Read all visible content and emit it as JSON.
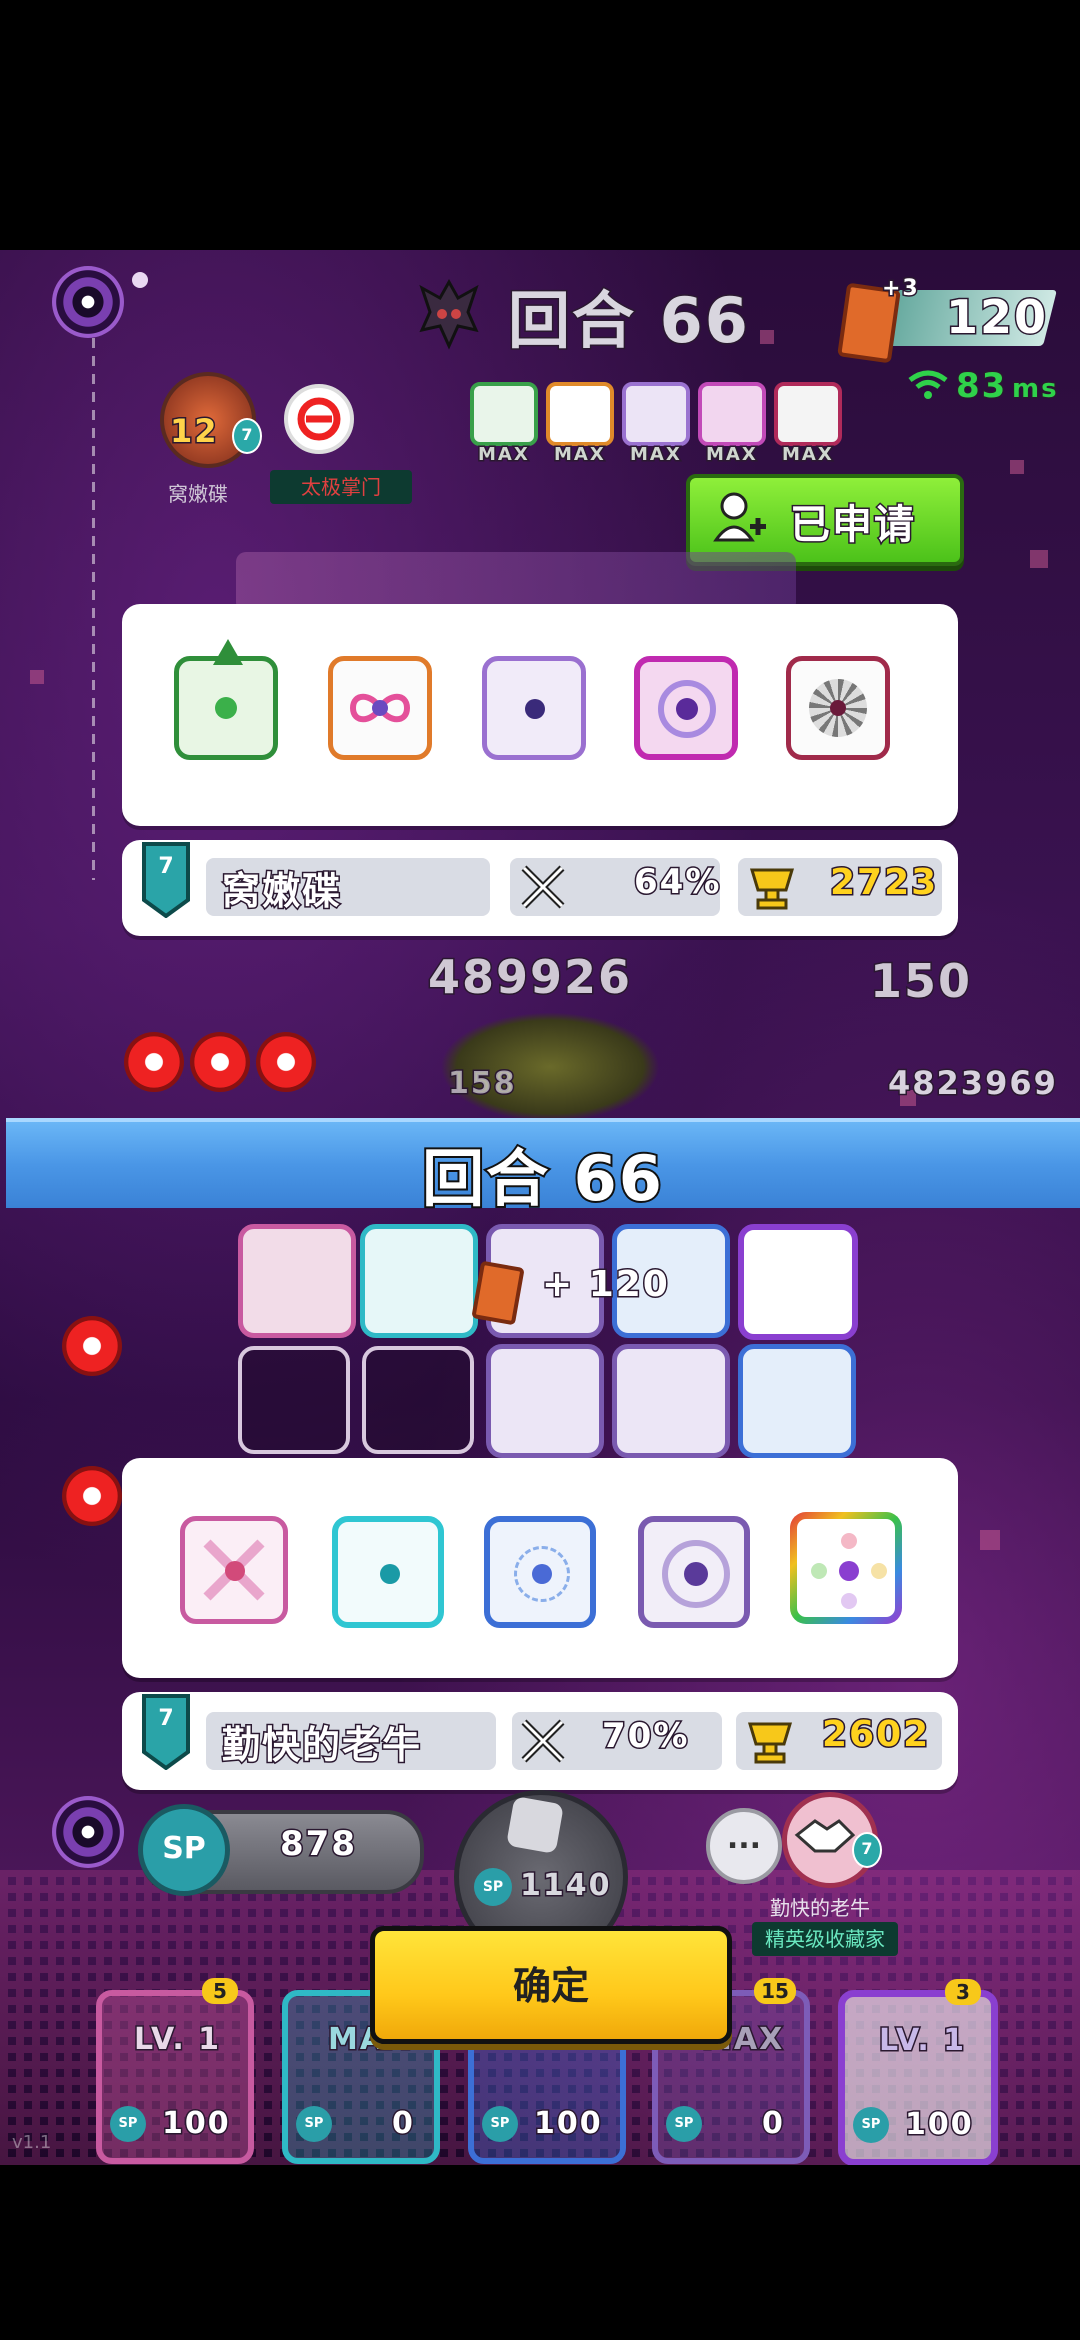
{
  "top_hud": {
    "round_label": "回合 66",
    "currency_bonus": "+3",
    "currency_value": "120",
    "ping_value": "83",
    "ping_unit": "ms",
    "player_level": "12",
    "player_badge": "7",
    "player_name": "窝嫩碟",
    "player_title": "太极掌门",
    "max_labels": [
      "MAX",
      "MAX",
      "MAX",
      "MAX",
      "MAX"
    ]
  },
  "apply_button": {
    "label": "已申请"
  },
  "opponent_panel": {
    "deck": [
      "nature-dragon-dice",
      "infinity-dragon-dice",
      "electric-dice",
      "warp-dice",
      "blade-dragon-dice"
    ],
    "rank": "7",
    "name": "窝嫩碟",
    "win_rate": "64%",
    "trophies": "2723"
  },
  "battle": {
    "boss_hp": "489926",
    "right_value": "150",
    "right_hp": "4823969",
    "left_small": "158"
  },
  "round_banner": {
    "text": "回合  66"
  },
  "reward_popup": {
    "amount": "+ 120"
  },
  "player_panel": {
    "deck": [
      "sword-dragon-dice",
      "ice-cross-dice",
      "snow-dragon-dice",
      "shield-dragon-dice",
      "rainbow-dice"
    ],
    "rank": "7",
    "name": "勤快的老牛",
    "win_rate": "70%",
    "trophies": "2602"
  },
  "bottom_hud": {
    "sp_label": "SP",
    "sp_value": "878",
    "spawn_sp_label": "SP",
    "spawn_cost": "1140",
    "chat_icon": "...",
    "partner_badge": "7",
    "partner_name": "勤快的老牛",
    "partner_title": "精英级收藏家",
    "version": "v1.1"
  },
  "confirm_button": {
    "label": "确定"
  },
  "upgrade_cards": [
    {
      "level": "LV. 1",
      "count": "5",
      "sp": "SP",
      "cost": "100",
      "color": "#c85aa0"
    },
    {
      "level": "MAX",
      "count": "",
      "sp": "SP",
      "cost": "0",
      "color": "#2fb9c6"
    },
    {
      "level": "",
      "count": "",
      "sp": "SP",
      "cost": "100",
      "color": "#3c6fd6"
    },
    {
      "level": "MAX",
      "count": "15",
      "sp": "SP",
      "cost": "0",
      "color": "#7d5cb8"
    },
    {
      "level": "LV. 1",
      "count": "3",
      "sp": "SP",
      "cost": "100",
      "color": "#8a3fd0"
    }
  ]
}
